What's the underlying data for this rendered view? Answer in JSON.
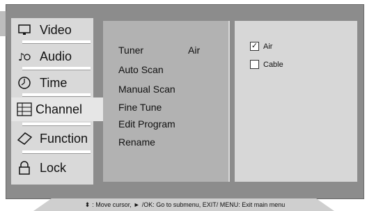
{
  "main_menu": {
    "items": [
      {
        "label": "Video",
        "icon": "monitor-icon"
      },
      {
        "label": "Audio",
        "icon": "music-note-icon"
      },
      {
        "label": "Time",
        "icon": "clock-icon"
      },
      {
        "label": "Channel",
        "icon": "channel-grid-icon",
        "selected": true
      },
      {
        "label": "Function",
        "icon": "diamond-icon"
      },
      {
        "label": "Lock",
        "icon": "padlock-icon"
      }
    ]
  },
  "submenu": {
    "items": [
      {
        "label": "Tuner",
        "value": "Air"
      },
      {
        "label": "Auto Scan"
      },
      {
        "label": "Manual Scan"
      },
      {
        "label": "Fine Tune"
      },
      {
        "label": "Edit Program"
      },
      {
        "label": "Rename"
      }
    ]
  },
  "options": [
    {
      "label": "Air",
      "checked": true
    },
    {
      "label": "Cable",
      "checked": false
    }
  ],
  "hint": {
    "part1": ": Move cursor,",
    "part2": "/OK: Go to submenu, EXIT/ MENU: Exit main menu"
  },
  "colors": {
    "frame": "#8c8c8c",
    "menu": "#d9d9d9",
    "submenu": "#b2b2b2",
    "options": "#d7d7d7"
  }
}
